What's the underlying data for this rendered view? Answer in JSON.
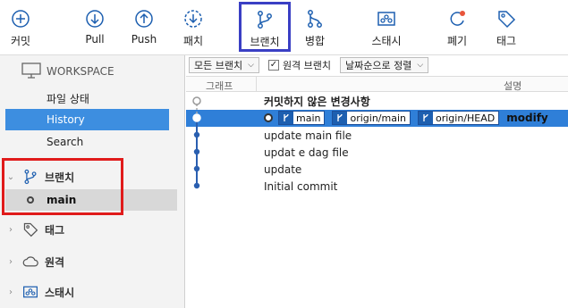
{
  "toolbar": {
    "commit": "커밋",
    "pull": "Pull",
    "push": "Push",
    "patch": "패치",
    "branch": "브랜치",
    "merge": "병합",
    "stash": "스태시",
    "discard": "폐기",
    "tag": "태그"
  },
  "sidebar": {
    "workspace": "WORKSPACE",
    "items": [
      "파일 상태",
      "History",
      "Search"
    ],
    "sections": {
      "branches": "브랜치",
      "tags": "태그",
      "remotes": "원격",
      "stashes": "스태시"
    },
    "current_branch": "main"
  },
  "filters": {
    "branches_dropdown": "모든 브랜치",
    "remote_branches": "원격 브랜치",
    "remote_branches_checked": true,
    "sort_dropdown": "날짜순으로 정렬"
  },
  "columns": {
    "graph": "그래프",
    "description": "설명"
  },
  "commits": {
    "uncommitted": "커밋하지 않은 변경사항",
    "head_refs": [
      "main",
      "origin/main",
      "origin/HEAD"
    ],
    "head_message": "modify",
    "others": [
      "update main file",
      "updat e dag file",
      "update",
      "Initial commit"
    ]
  },
  "colors": {
    "selection": "#2f7fd8",
    "sidebar_selection": "#3d8ee0",
    "icon_blue": "#1d5fb0",
    "highlight_box": "#3a3fc4",
    "red_box": "#e01b1b"
  }
}
